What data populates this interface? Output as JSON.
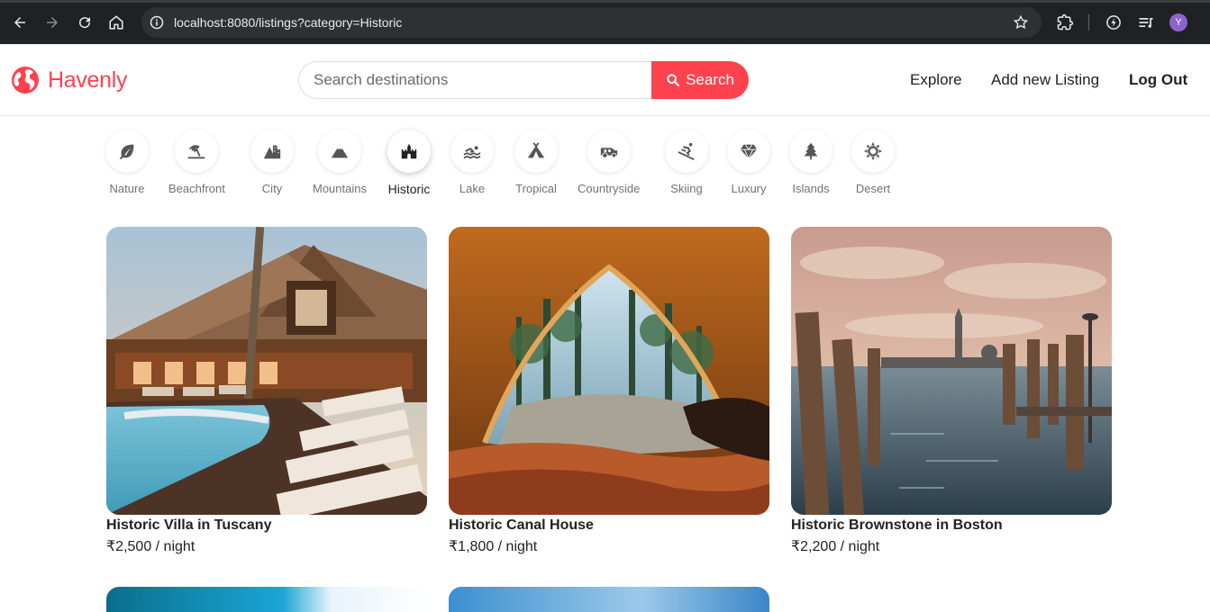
{
  "browser": {
    "url": "localhost:8080/listings?category=Historic",
    "profile_initial": "Y"
  },
  "header": {
    "brand": "Havenly",
    "search_placeholder": "Search destinations",
    "search_button": "Search",
    "nav": {
      "explore": "Explore",
      "add_listing": "Add new Listing",
      "logout": "Log Out"
    }
  },
  "filters": [
    {
      "label": "Nature",
      "icon": "leaf-icon"
    },
    {
      "label": "Beachfront",
      "icon": "umbrella-beach-icon"
    },
    {
      "label": "City",
      "icon": "city-buildings-icon"
    },
    {
      "label": "Mountains",
      "icon": "mountain-icon"
    },
    {
      "label": "Historic",
      "icon": "castle-icon",
      "active": true
    },
    {
      "label": "Lake",
      "icon": "swimmer-icon"
    },
    {
      "label": "Tropical",
      "icon": "campground-tent-icon"
    },
    {
      "label": "Countryside",
      "icon": "tractor-icon"
    },
    {
      "label": "Skiing",
      "icon": "skier-icon"
    },
    {
      "label": "Luxury",
      "icon": "gem-icon"
    },
    {
      "label": "Islands",
      "icon": "tree-icon"
    },
    {
      "label": "Desert",
      "icon": "sun-icon"
    }
  ],
  "listings": [
    {
      "title": "Historic Villa in Tuscany",
      "price": "₹2,500 / night"
    },
    {
      "title": "Historic Canal House",
      "price": "₹1,800 / night"
    },
    {
      "title": "Historic Brownstone in Boston",
      "price": "₹2,200 / night"
    }
  ],
  "colors": {
    "brand": "#fe424d",
    "text": "#222222",
    "muted": "#717171"
  }
}
